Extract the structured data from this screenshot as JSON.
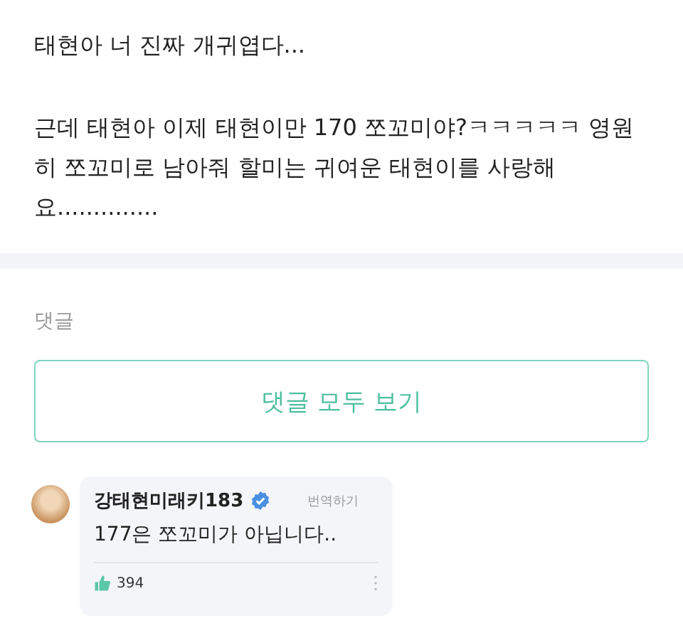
{
  "post": {
    "paragraphs": [
      "태현아 너 진짜 개귀엽다...",
      "근데 태현아 이제 태현이만 170 쪼꼬미야?ㅋㅋㅋㅋㅋ 영원히 쪼꼬미로 남아줘 할미는 귀여운 태현이를 사랑해요.............."
    ]
  },
  "comments_section": {
    "heading": "댓글",
    "view_all_button": "댓글 모두 보기"
  },
  "comments": [
    {
      "author": "강태현미래키183",
      "verified": true,
      "translate": "번역하기",
      "text": "177은 쪼꼬미가 아닙니다..",
      "likes": "394"
    }
  ]
}
